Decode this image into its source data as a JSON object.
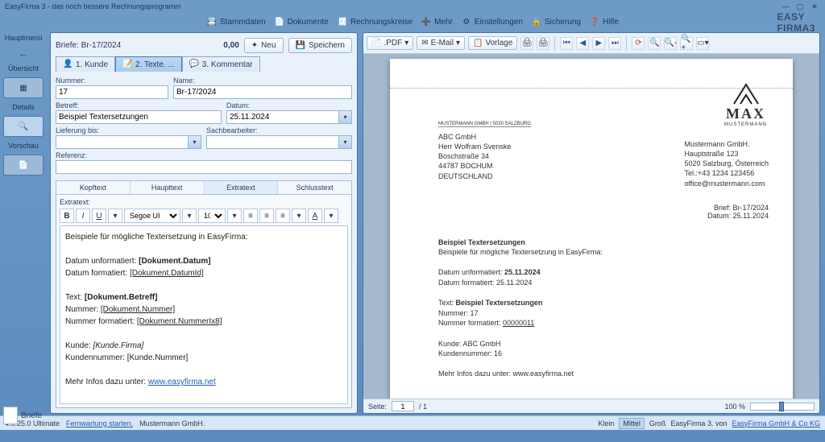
{
  "window": {
    "title": "EasyFirma 3 - das noch bessere Rechnungsprogramm"
  },
  "brand": {
    "line1": "EASY",
    "line2": "FIRMA",
    "ver": "3"
  },
  "menubar": [
    {
      "icon": "📇",
      "label": "Stammdaten"
    },
    {
      "icon": "📄",
      "label": "Dokumente"
    },
    {
      "icon": "🧾",
      "label": "Rechnungskreise"
    },
    {
      "icon": "➕",
      "label": "Mehr"
    },
    {
      "icon": "⚙",
      "label": "Einstellungen"
    },
    {
      "icon": "🔒",
      "label": "Sicherung"
    },
    {
      "icon": "❓",
      "label": "Hilfe"
    }
  ],
  "sidenav": {
    "heading": "Hauptmenü",
    "items": [
      {
        "label": "Übersicht",
        "icon": "▦"
      },
      {
        "label": "Details",
        "icon": "🔍"
      },
      {
        "label": "Vorschau",
        "icon": "📄"
      }
    ]
  },
  "bottom": {
    "label": "Briefe"
  },
  "form": {
    "breadcrumb": "Briefe: Br-17/2024",
    "amount": "0,00",
    "buttons": {
      "new": "Neu",
      "save": "Speichern"
    },
    "tabs": [
      {
        "label": "1. Kunde"
      },
      {
        "label": "2. Texte. ..."
      },
      {
        "label": "3. Kommentar"
      }
    ],
    "fields": {
      "nummer_label": "Nummer:",
      "nummer": "17",
      "name_label": "Name:",
      "name": "Br-17/2024",
      "betreff_label": "Betreff:",
      "betreff": "Beispiel Textersetzungen",
      "datum_label": "Datum:",
      "datum": "25.11.2024",
      "lieferung_label": "Lieferung bis:",
      "lieferung": "",
      "sach_label": "Sachbearbeiter:",
      "sach": "",
      "referenz_label": "Referenz:",
      "referenz": ""
    },
    "subtabs": [
      "Kopftext",
      "Haupttext",
      "Extratext",
      "Schlusstext"
    ],
    "editor": {
      "label": "Extratext:",
      "font": "Segoe UI",
      "size": "10",
      "lines": {
        "l1": "Beispiele für mögliche Textersetzung in EasyFirma:",
        "l2": "Datum unformatiert: ",
        "l2b": "[Dokument.Datum]",
        "l3": "Datum formatiert: ",
        "l3b": "[Dokument.DatumId]",
        "l4": "Text: ",
        "l4b": "[Dokument.Betreff]",
        "l5": "Nummer: ",
        "l5b": "[Dokument.Nummer]",
        "l6": "Nummer formatiert: ",
        "l6b": "[Dokument.NummerIx8]",
        "l7": "Kunde: ",
        "l7b": "[Kunde.Firma]",
        "l8": "Kundennummer: ",
        "l8b": "[Kunde.Nummer]",
        "l9": "Mehr Infos dazu unter: ",
        "l9b": "www.easyfirma.net"
      }
    }
  },
  "preview": {
    "toolbar": {
      "pdf": ".PDF",
      "email": "E-Mail",
      "vorlage": "Vorlage"
    },
    "footer": {
      "seite_label": "Seite:",
      "page": "1",
      "total": "/ 1",
      "zoom": "100 %"
    },
    "page": {
      "sender": "MUSTERMANN GMBH | 5020 SALZBURG",
      "recip": {
        "l1": "ABC GmbH",
        "l2": "Herr Wolfram Svenske",
        "l3": "Boschstraße 34",
        "l4": "44787 BOCHUM",
        "l5": "DEUTSCHLAND"
      },
      "company": {
        "l1": "Mustermann GmbH.",
        "l2": "Hauptstraße 123",
        "l3": "5020 Salzburg, Österreich",
        "l4": "Tel.:+43 1234 123456",
        "l5": "office@mustermann.com"
      },
      "logo": {
        "name": "MAX",
        "sub": "MUSTERMANN"
      },
      "ref": {
        "l1": "Brief: Br-17/2024",
        "l2": "Datum: 25.11.2024"
      },
      "body": {
        "h": "Beispiel Textersetzungen",
        "p1": "Beispiele für mögliche Textersetzung in EasyFirma:",
        "d1a": "Datum unformatiert: ",
        "d1b": "25.11.2024",
        "d2": "Datum formatiert: 25.11.2024",
        "t1a": "Text: ",
        "t1b": "Beispiel Textersetzungen",
        "n1": "Nummer: 17",
        "n2a": "Nummer formatiert: ",
        "n2b": "00000011",
        "k1": "Kunde: ABC GmbH",
        "k2": "Kundennummer: 16",
        "m1": "Mehr Infos dazu unter: www.easyfirma.net"
      }
    }
  },
  "status": {
    "ver": "4.0.25.0 Ultimate",
    "fernwartung": "Fernwartung starten.",
    "co": "Mustermann GmbH.",
    "klein": "Klein",
    "mittel": "Mittel",
    "gross": "Groß",
    "prod": "EasyFirma 3. von",
    "link": "EasyFirma GmbH & Co KG"
  }
}
